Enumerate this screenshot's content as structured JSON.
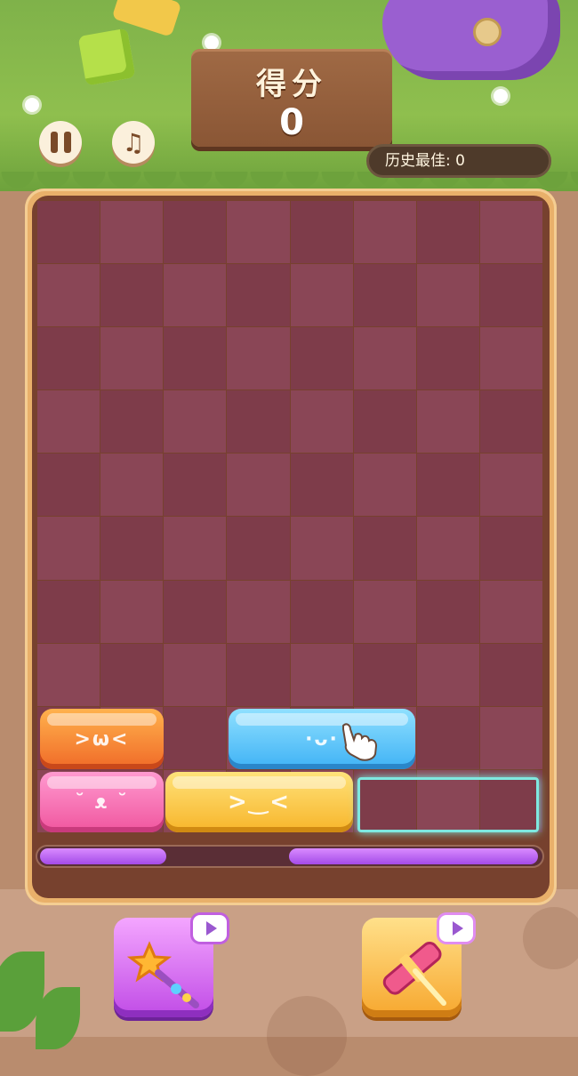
{
  "header": {
    "score_title": "得分",
    "score_value": "0",
    "best_label": "历史最佳:",
    "best_value": "0"
  },
  "controls": {
    "pause_icon": "pause-icon",
    "music_icon": "music-note-icon",
    "music_glyph": "♫"
  },
  "board": {
    "rows": 10,
    "cols": 8,
    "blocks": [
      {
        "color": "orange",
        "face": ">ω<",
        "row": 9,
        "col": 1,
        "span": 2
      },
      {
        "color": "blue",
        "face": "·ᴗ·",
        "row": 9,
        "col": 4,
        "span": 3
      },
      {
        "color": "pink",
        "face": "˘ ᴥ ˘",
        "row": 10,
        "col": 1,
        "span": 2
      },
      {
        "color": "yellow",
        "face": ">‿<",
        "row": 10,
        "col": 3,
        "span": 3
      }
    ],
    "ghost_target": {
      "row": 10,
      "col": 6,
      "span": 3
    }
  },
  "progress": {
    "left_fill": 0.25,
    "right_fill": 0.5
  },
  "tools": [
    {
      "name": "magic-wand",
      "icon": "magic-wand-icon",
      "has_ad": true
    },
    {
      "name": "hammer",
      "icon": "hammer-icon",
      "has_ad": true
    }
  ],
  "colors": {
    "board_cell": "#7e3c4a",
    "board_cell_alt": "#8a4656",
    "progress": "#b55bee",
    "ghost": "#7fe8e0"
  }
}
